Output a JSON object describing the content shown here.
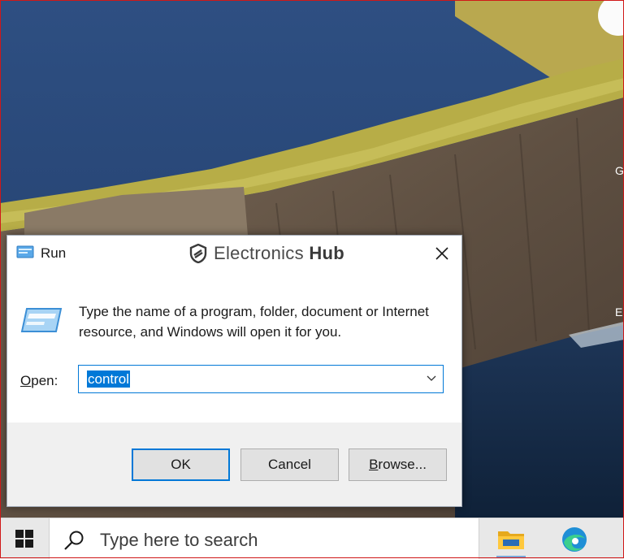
{
  "desktop": {
    "side_letters": [
      "G",
      "E"
    ]
  },
  "run_dialog": {
    "title": "Run",
    "watermark": {
      "brand_light": "Electronics",
      "brand_bold": "Hub"
    },
    "close_icon": "close-icon",
    "description": "Type the name of a program, folder, document or Internet resource, and Windows will open it for you.",
    "open_label_mnemonic": "O",
    "open_label_rest": "pen:",
    "open_value": "control",
    "buttons": {
      "ok": "OK",
      "cancel": "Cancel",
      "browse_mnemonic": "B",
      "browse_rest": "rowse..."
    },
    "colors": {
      "accent": "#0078d7",
      "button_bg": "#e1e1e1"
    }
  },
  "taskbar": {
    "search_placeholder": "Type here to search",
    "icons": [
      "windows-start-icon",
      "search-icon",
      "file-explorer-icon",
      "edge-icon"
    ]
  }
}
